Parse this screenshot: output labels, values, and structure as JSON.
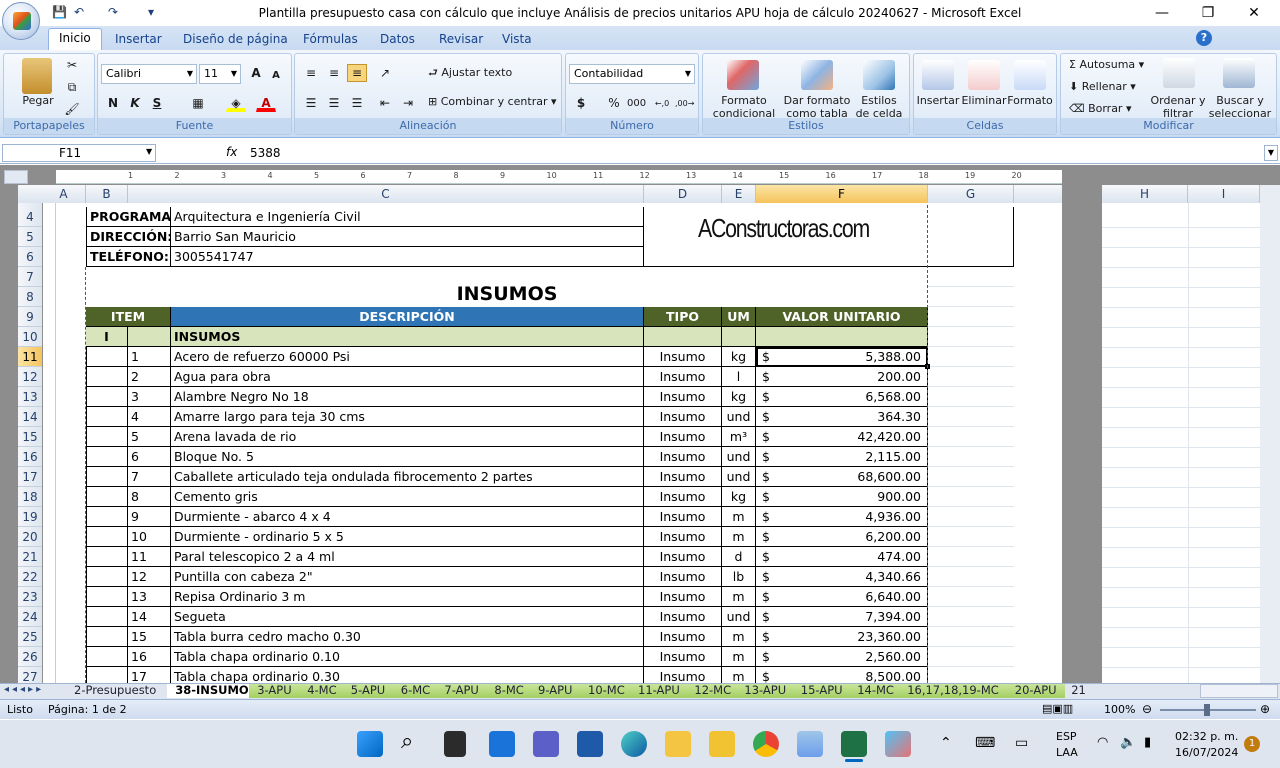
{
  "window": {
    "title": "Plantilla presupuesto casa con cálculo que incluye Análisis de precios unitarios APU  hoja de cálculo 20240627 - Microsoft Excel",
    "controls": {
      "minimize": "—",
      "restore": "❐",
      "close": "✕"
    }
  },
  "qat": {
    "save": "💾",
    "undo": "↶",
    "redo": "↷",
    "more": "▾"
  },
  "ribbon": {
    "tabs": [
      "Inicio",
      "Insertar",
      "Diseño de página",
      "Fórmulas",
      "Datos",
      "Revisar",
      "Vista"
    ],
    "active_tab": "Inicio",
    "help": "?",
    "portapapeles": {
      "label": "Portapapeles",
      "pegar": "Pegar"
    },
    "fuente": {
      "label": "Fuente",
      "font": "Calibri",
      "size": "11",
      "bold": "N",
      "italic": "K",
      "underline": "S",
      "grow": "A",
      "shrink": "A"
    },
    "alineacion": {
      "label": "Alineación",
      "wrap": "Ajustar texto",
      "merge": "Combinar y centrar"
    },
    "numero": {
      "label": "Número",
      "format": "Contabilidad",
      "currency": "$",
      "percent": "%",
      "thousands": "000",
      "inc": "←,0",
      "dec": ",00→"
    },
    "estilos": {
      "label": "Estilos",
      "cond": "Formato condicional",
      "table": "Dar formato como tabla",
      "cell": "Estilos de celda"
    },
    "celdas": {
      "label": "Celdas",
      "insert": "Insertar",
      "delete": "Eliminar",
      "format": "Formato"
    },
    "modificar": {
      "label": "Modificar",
      "autosum": "Autosuma",
      "fill": "Rellenar",
      "clear": "Borrar",
      "sort": "Ordenar y filtrar",
      "find": "Buscar y seleccionar"
    }
  },
  "formula_bar": {
    "name_box": "F11",
    "fx": "fx",
    "value": "5388"
  },
  "columns": [
    "A",
    "B",
    "C",
    "D",
    "E",
    "F",
    "G",
    "H",
    "I"
  ],
  "ruler_numbers": [
    "1",
    "2",
    "3",
    "4",
    "5",
    "6",
    "7",
    "8",
    "9",
    "10",
    "11",
    "12",
    "13",
    "14",
    "15",
    "16",
    "17",
    "18",
    "19",
    "20"
  ],
  "rows": [
    "4",
    "5",
    "6",
    "7",
    "8",
    "9",
    "10",
    "11",
    "12",
    "13",
    "14",
    "15",
    "16",
    "17",
    "18",
    "19",
    "20",
    "21",
    "22",
    "23",
    "24",
    "25",
    "26",
    "27"
  ],
  "header_info": [
    {
      "label": "PROGRAMA:",
      "value": "Arquitectura e Ingeniería Civil"
    },
    {
      "label": "DIRECCIÓN:",
      "value": "Barrio San Mauricio"
    },
    {
      "label": "TELÉFONO:",
      "value": "3005541747"
    }
  ],
  "logo_text": "AConstructoras.com",
  "sheet_title": "INSUMOS",
  "table_headers": {
    "item": "ITEM",
    "descripcion": "DESCRIPCIÓN",
    "tipo": "TIPO",
    "um": "UM",
    "valor": "VALOR UNITARIO"
  },
  "section": {
    "num": "I",
    "name": "INSUMOS"
  },
  "currency_symbol": "$",
  "items": [
    {
      "n": "1",
      "desc": "Acero de refuerzo 60000 Psi",
      "tipo": "Insumo",
      "um": "kg",
      "valor": "5,388.00"
    },
    {
      "n": "2",
      "desc": "Agua para obra",
      "tipo": "Insumo",
      "um": "l",
      "valor": "200.00"
    },
    {
      "n": "3",
      "desc": "Alambre Negro No 18",
      "tipo": "Insumo",
      "um": "kg",
      "valor": "6,568.00"
    },
    {
      "n": "4",
      "desc": "Amarre largo para teja 30 cms",
      "tipo": "Insumo",
      "um": "und",
      "valor": "364.30"
    },
    {
      "n": "5",
      "desc": "Arena lavada de rio",
      "tipo": "Insumo",
      "um": "m³",
      "valor": "42,420.00"
    },
    {
      "n": "6",
      "desc": "Bloque No. 5",
      "tipo": "Insumo",
      "um": "und",
      "valor": "2,115.00"
    },
    {
      "n": "7",
      "desc": "Caballete articulado teja ondulada fibrocemento 2 partes",
      "tipo": "Insumo",
      "um": "und",
      "valor": "68,600.00"
    },
    {
      "n": "8",
      "desc": "Cemento gris",
      "tipo": "Insumo",
      "um": "kg",
      "valor": "900.00"
    },
    {
      "n": "9",
      "desc": "Durmiente - abarco 4 x 4",
      "tipo": "Insumo",
      "um": "m",
      "valor": "4,936.00"
    },
    {
      "n": "10",
      "desc": "Durmiente - ordinario 5 x 5",
      "tipo": "Insumo",
      "um": "m",
      "valor": "6,200.00"
    },
    {
      "n": "11",
      "desc": "Paral telescopico 2 a 4 ml",
      "tipo": "Insumo",
      "um": "d",
      "valor": "474.00"
    },
    {
      "n": "12",
      "desc": "Puntilla con cabeza 2\"",
      "tipo": "Insumo",
      "um": "lb",
      "valor": "4,340.66"
    },
    {
      "n": "13",
      "desc": "Repisa Ordinario 3 m",
      "tipo": "Insumo",
      "um": "m",
      "valor": "6,640.00"
    },
    {
      "n": "14",
      "desc": "Segueta",
      "tipo": "Insumo",
      "um": "und",
      "valor": "7,394.00"
    },
    {
      "n": "15",
      "desc": "Tabla burra cedro macho 0.30",
      "tipo": "Insumo",
      "um": "m",
      "valor": "23,360.00"
    },
    {
      "n": "16",
      "desc": "Tabla chapa ordinario 0.10",
      "tipo": "Insumo",
      "um": "m",
      "valor": "2,560.00"
    },
    {
      "n": "17",
      "desc": "Tabla chapa ordinario 0.30",
      "tipo": "Insumo",
      "um": "m",
      "valor": "8,500.00"
    }
  ],
  "sheet_tabs": [
    "2-Presupuesto",
    "38-INSUMOS",
    "3-APU",
    "4-MC",
    "5-APU",
    "6-MC",
    "7-APU",
    "8-MC",
    "9-APU",
    "10-MC",
    "11-APU",
    "12-MC",
    "13-APU",
    "15-APU",
    "14-MC",
    "16,17,18,19-MC",
    "20-APU",
    "21"
  ],
  "active_sheet": "38-INSUMOS",
  "status": {
    "mode": "Listo",
    "page": "Página: 1 de 2",
    "zoom": "100%"
  },
  "taskbar": {
    "lang1": "ESP",
    "lang2": "LAA",
    "time": "02:32 p. m.",
    "date": "16/07/2024",
    "badge": "1"
  },
  "colors": {
    "accent": "#2f75b5",
    "header_green": "#4f6228",
    "section_green": "#d8e4bc",
    "selection": "#f5c35c"
  }
}
